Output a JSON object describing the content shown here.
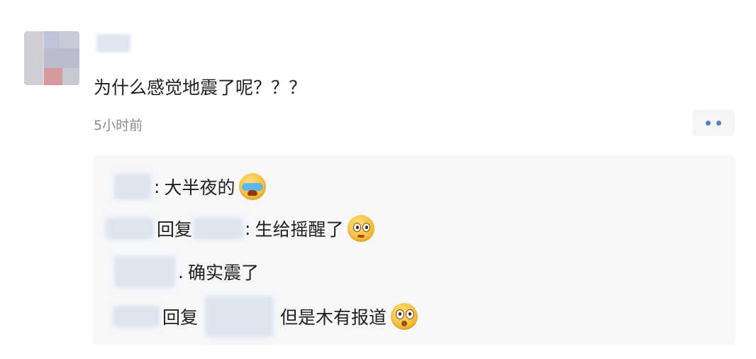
{
  "comment": {
    "text": "为什么感觉地震了呢？？？",
    "time": "5小时前",
    "more_icon": "more-dots-icon"
  },
  "replies": [
    {
      "prefix": ":",
      "text": "大半夜的",
      "emoji": "crying-emoji"
    },
    {
      "reply_word": "回复",
      "colon": ":",
      "text": "生给摇醒了",
      "emoji": "worried-emoji"
    },
    {
      "prefix": ".",
      "text": "确实震了"
    },
    {
      "reply_word": "回复",
      "text": "但是木有报道",
      "emoji": "shocked-emoji"
    }
  ],
  "colors": {
    "accent": "#5a7fc7",
    "reply_background": "#f6f7f9",
    "time_text": "#8a8a8a"
  }
}
